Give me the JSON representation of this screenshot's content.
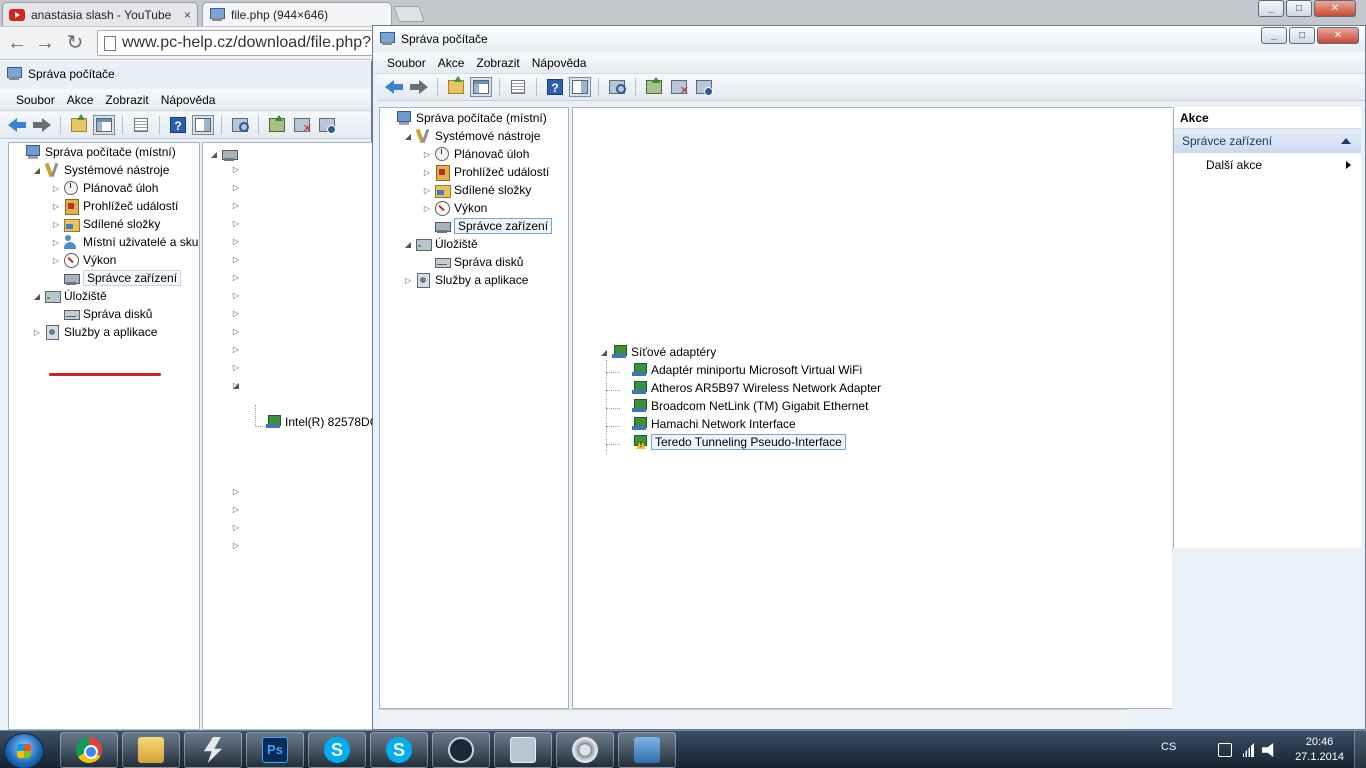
{
  "browser": {
    "tabs": [
      {
        "title": "anastasia slash - YouTube",
        "icon": "youtube-icon"
      },
      {
        "title": "file.php (944×646)",
        "icon": "computer-management-icon"
      }
    ],
    "close_glyph": "×",
    "url": "www.pc-help.cz/download/file.php?"
  },
  "left_window": {
    "title": "Správa počítače",
    "menu": [
      "Soubor",
      "Akce",
      "Zobrazit",
      "Nápověda"
    ],
    "tree": [
      {
        "label": "Správa počítače (místní)",
        "icon": "computer-management-icon",
        "indent": 0,
        "expander": ""
      },
      {
        "label": "Systémové nástroje",
        "icon": "system-tools-icon",
        "indent": 1,
        "expander": "◢"
      },
      {
        "label": "Plánovač úloh",
        "icon": "task-scheduler-icon",
        "indent": 2,
        "expander": "▷"
      },
      {
        "label": "Prohlížeč událostí",
        "icon": "event-viewer-icon",
        "indent": 2,
        "expander": "▷"
      },
      {
        "label": "Sdílené složky",
        "icon": "shared-folders-icon",
        "indent": 2,
        "expander": "▷"
      },
      {
        "label": "Místní uživatelé a skupiny",
        "icon": "local-users-icon",
        "indent": 2,
        "expander": "▷"
      },
      {
        "label": "Výkon",
        "icon": "performance-icon",
        "indent": 2,
        "expander": "▷"
      },
      {
        "label": "Správce zařízení",
        "icon": "device-manager-icon",
        "indent": 2,
        "expander": ""
      },
      {
        "label": "Úložiště",
        "icon": "storage-icon",
        "indent": 1,
        "expander": "◢"
      },
      {
        "label": "Správa disků",
        "icon": "disk-management-icon",
        "indent": 2,
        "expander": ""
      },
      {
        "label": "Služby a aplikace",
        "icon": "services-icon",
        "indent": 1,
        "expander": "▷"
      }
    ],
    "device_partial_label": "Intel(R) 82578DC"
  },
  "right_window": {
    "title": "Správa počítače",
    "menu": [
      "Soubor",
      "Akce",
      "Zobrazit",
      "Nápověda"
    ],
    "tree": [
      {
        "label": "Správa počítače (místní)",
        "icon": "computer-management-icon",
        "indent": 0,
        "expander": ""
      },
      {
        "label": "Systémové nástroje",
        "icon": "system-tools-icon",
        "indent": 1,
        "expander": "◢"
      },
      {
        "label": "Plánovač úloh",
        "icon": "task-scheduler-icon",
        "indent": 2,
        "expander": "▷"
      },
      {
        "label": "Prohlížeč událostí",
        "icon": "event-viewer-icon",
        "indent": 2,
        "expander": "▷"
      },
      {
        "label": "Sdílené složky",
        "icon": "shared-folders-icon",
        "indent": 2,
        "expander": "▷"
      },
      {
        "label": "Výkon",
        "icon": "performance-icon",
        "indent": 2,
        "expander": "▷"
      },
      {
        "label": "Správce zařízení",
        "icon": "device-manager-icon",
        "indent": 2,
        "expander": ""
      },
      {
        "label": "Úložiště",
        "icon": "storage-icon",
        "indent": 1,
        "expander": "◢"
      },
      {
        "label": "Správa disků",
        "icon": "disk-management-icon",
        "indent": 2,
        "expander": ""
      },
      {
        "label": "Služby a aplikace",
        "icon": "services-icon",
        "indent": 1,
        "expander": "▷"
      }
    ],
    "device_category": {
      "label": "Síťové adaptéry",
      "expander": "◢"
    },
    "devices": [
      {
        "label": "Adaptér miniportu Microsoft Virtual WiFi",
        "warning": false
      },
      {
        "label": "Atheros AR5B97 Wireless Network Adapter",
        "warning": false
      },
      {
        "label": "Broadcom NetLink (TM) Gigabit Ethernet",
        "warning": false
      },
      {
        "label": "Hamachi Network Interface",
        "warning": false
      },
      {
        "label": "Teredo Tunneling Pseudo-Interface",
        "warning": true
      }
    ],
    "actions": {
      "title": "Akce",
      "section": "Správce zařízení",
      "items": [
        "Další akce"
      ]
    }
  },
  "taskbar": {
    "apps": [
      "chrome-icon",
      "explorer-icon",
      "bolt-icon",
      "photoshop-icon",
      "skype-icon",
      "skype-icon",
      "steam-icon",
      "device-manager-icon",
      "speaker-icon",
      "network-app-icon"
    ],
    "ps_label": "Ps",
    "skype_label": "S",
    "language": "CS",
    "time": "20:46",
    "date": "27.1.2014"
  },
  "colors": {
    "annotation_underline": "#d0202a",
    "taskbar_top": "#3b4f66",
    "window_frame": "#e8f0f8"
  }
}
